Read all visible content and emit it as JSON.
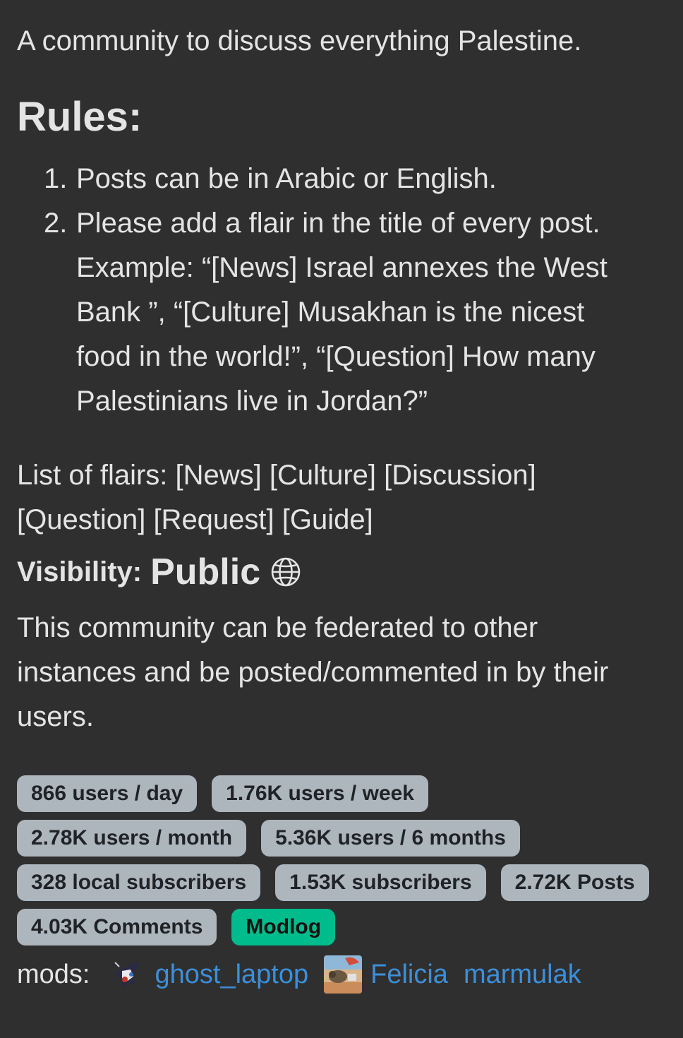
{
  "intro": "A community to discuss everything Palestine.",
  "rules": {
    "heading": "Rules:",
    "items": [
      {
        "num": "1.",
        "text": "Posts can be in Arabic or English."
      },
      {
        "num": "2.",
        "text": "Please add a flair in the title of every post. Example: “[News] Israel annexes the West Bank ”, “[Culture] Musakhan is the nicest food in the world!”, “[Question] How many Palestinians live in Jordan?”"
      }
    ]
  },
  "flairs": "List of flairs: [News] [Culture] [Discussion] [Question] [Request] [Guide]",
  "visibility": {
    "label": "Visibility:",
    "value": "Public",
    "icon": "globe-icon"
  },
  "federated": "This community can be federated to other instances and be posted/commented in by their users.",
  "stats": {
    "users_day": "866 users / day",
    "users_week": "1.76K users / week",
    "users_month": "2.78K users / month",
    "users_6months": "5.36K users / 6 months",
    "local_subscribers": "328 local subscribers",
    "subscribers": "1.53K subscribers",
    "posts": "2.72K Posts",
    "comments": "4.03K Comments",
    "modlog": "Modlog"
  },
  "mods": {
    "label": "mods:",
    "list": [
      {
        "name": "ghost_laptop"
      },
      {
        "name": "Felicia"
      },
      {
        "name": "marmulak"
      }
    ]
  },
  "colors": {
    "background": "#2f2f2f",
    "text": "#e4e4e4",
    "badge": "#adb5bd",
    "modlog": "#00bc8c",
    "link": "#3d8fd9"
  }
}
